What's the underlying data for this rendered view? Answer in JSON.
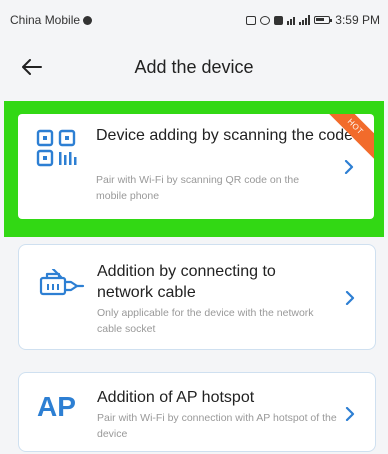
{
  "status_bar": {
    "carrier": "China Mobile",
    "time": "3:59 PM",
    "icons": [
      "signal-icon",
      "wifi-icon",
      "battery-icon"
    ]
  },
  "header": {
    "title": "Add the device",
    "back_icon": "back-arrow-icon"
  },
  "highlight_color": "#32d814",
  "accent_color": "#2d7fd3",
  "options": [
    {
      "icon": "qr-code-icon",
      "title": "Device adding by scanning the code",
      "description": "Pair with Wi-Fi by scanning QR code on the mobile phone",
      "badge": "HOT",
      "highlighted": true
    },
    {
      "icon": "network-cable-icon",
      "title": "Addition by connecting to network cable",
      "description": "Only applicable for the device with the network cable socket"
    },
    {
      "icon": "ap-hotspot-icon",
      "icon_text": "AP",
      "title": "Addition of AP hotspot",
      "description": "Pair with Wi-Fi by connection with AP hotspot of the device"
    }
  ]
}
